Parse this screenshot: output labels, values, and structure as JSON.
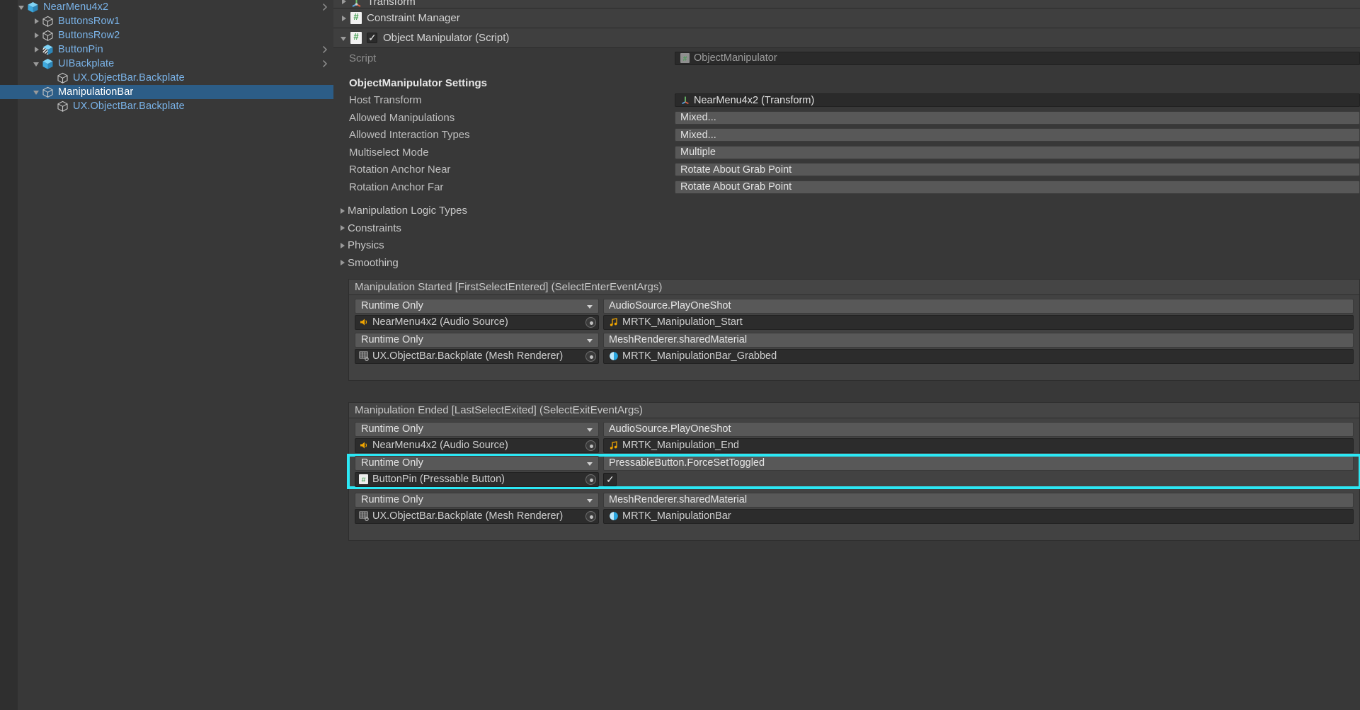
{
  "hierarchy": {
    "rows": [
      {
        "label": "NearMenu4x2",
        "depth": 1,
        "toggle": "down",
        "icon": "prefab-cube-icon",
        "selected": false,
        "chevron": true
      },
      {
        "label": "ButtonsRow1",
        "depth": 2,
        "toggle": "right",
        "icon": "gameobject-cube-icon",
        "selected": false,
        "chevron": false
      },
      {
        "label": "ButtonsRow2",
        "depth": 2,
        "toggle": "right",
        "icon": "gameobject-cube-icon",
        "selected": false,
        "chevron": false
      },
      {
        "label": "ButtonPin",
        "depth": 2,
        "toggle": "right",
        "icon": "prefab-variant-cube-icon",
        "selected": false,
        "chevron": true
      },
      {
        "label": "UIBackplate",
        "depth": 2,
        "toggle": "down",
        "icon": "prefab-cube-icon",
        "selected": false,
        "chevron": true
      },
      {
        "label": "UX.ObjectBar.Backplate",
        "depth": 3,
        "toggle": "none",
        "icon": "gameobject-cube-icon",
        "selected": false,
        "chevron": false
      },
      {
        "label": "ManipulationBar",
        "depth": 2,
        "toggle": "down",
        "icon": "gameobject-cube-icon",
        "selected": true,
        "chevron": false
      },
      {
        "label": "UX.ObjectBar.Backplate",
        "depth": 3,
        "toggle": "none",
        "icon": "gameobject-cube-icon",
        "selected": false,
        "chevron": false
      }
    ]
  },
  "inspector": {
    "components": [
      {
        "title": "Transform",
        "icon": "transform-icon",
        "expanded": false,
        "has_checkbox": false
      },
      {
        "title": "Constraint Manager",
        "icon": "cs-script-icon",
        "expanded": false,
        "has_checkbox": false
      },
      {
        "title": "Object Manipulator (Script)",
        "icon": "cs-script-icon",
        "expanded": true,
        "has_checkbox": true,
        "checked": true
      }
    ],
    "script_row": {
      "label": "Script",
      "value": "ObjectManipulator",
      "icon": "cs-script-icon"
    },
    "settings_header": "ObjectManipulator Settings",
    "properties": [
      {
        "label": "Host Transform",
        "value": "NearMenu4x2 (Transform)",
        "type": "object",
        "icon": "transform-icon"
      },
      {
        "label": "Allowed Manipulations",
        "value": "Mixed...",
        "type": "enum"
      },
      {
        "label": "Allowed Interaction Types",
        "value": "Mixed...",
        "type": "enum"
      },
      {
        "label": "Multiselect Mode",
        "value": "Multiple",
        "type": "enum"
      },
      {
        "label": "Rotation Anchor Near",
        "value": "Rotate About Grab Point",
        "type": "enum"
      },
      {
        "label": "Rotation Anchor Far",
        "value": "Rotate About Grab Point",
        "type": "enum"
      }
    ],
    "foldouts": [
      {
        "label": "Manipulation Logic Types"
      },
      {
        "label": "Constraints"
      },
      {
        "label": "Physics"
      },
      {
        "label": "Smoothing"
      }
    ],
    "events": [
      {
        "title": "Manipulation Started [FirstSelectEntered] (SelectEnterEventArgs)",
        "entries": [
          {
            "highlighted": false,
            "mode": "Runtime Only",
            "method": "AudioSource.PlayOneShot",
            "target": "NearMenu4x2 (Audio Source)",
            "target_icon": "audio-source-icon",
            "arg_value": "MRTK_Manipulation_Start",
            "arg_icon": "audio-clip-icon",
            "arg_type": "object"
          },
          {
            "highlighted": false,
            "mode": "Runtime Only",
            "method": "MeshRenderer.sharedMaterial",
            "target": "UX.ObjectBar.Backplate (Mesh Renderer)",
            "target_icon": "mesh-renderer-icon",
            "arg_value": "MRTK_ManipulationBar_Grabbed",
            "arg_icon": "material-icon",
            "arg_type": "object"
          }
        ]
      },
      {
        "title": "Manipulation Ended [LastSelectExited] (SelectExitEventArgs)",
        "entries": [
          {
            "highlighted": false,
            "mode": "Runtime Only",
            "method": "AudioSource.PlayOneShot",
            "target": "NearMenu4x2 (Audio Source)",
            "target_icon": "audio-source-icon",
            "arg_value": "MRTK_Manipulation_End",
            "arg_icon": "audio-clip-icon",
            "arg_type": "object"
          },
          {
            "highlighted": true,
            "mode": "Runtime Only",
            "method": "PressableButton.ForceSetToggled",
            "target": "ButtonPin (Pressable Button)",
            "target_icon": "cs-script-icon",
            "arg_value": "",
            "arg_icon": "",
            "arg_type": "bool",
            "arg_checked": true
          },
          {
            "highlighted": false,
            "mode": "Runtime Only",
            "method": "MeshRenderer.sharedMaterial",
            "target": "UX.ObjectBar.Backplate (Mesh Renderer)",
            "target_icon": "mesh-renderer-icon",
            "arg_value": "MRTK_ManipulationBar",
            "arg_icon": "material-icon",
            "arg_type": "object"
          }
        ]
      }
    ]
  },
  "colors": {
    "highlight": "#2ce8f5",
    "selection": "#2c5d87",
    "hierarchy_text": "#7ab3e8",
    "panel_bg": "#383838"
  }
}
